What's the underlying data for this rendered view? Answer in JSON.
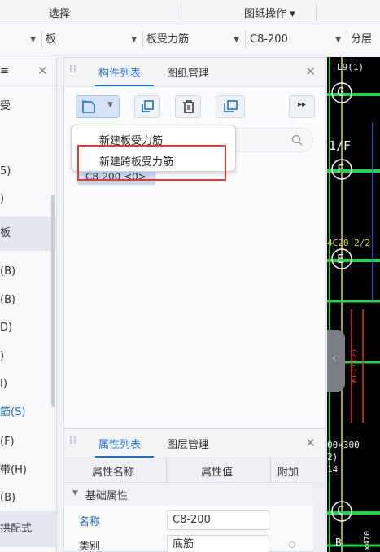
{
  "ribbon": {
    "select_label": "选择",
    "drawing_ops_label": "图纸操作 ▾"
  },
  "combos": {
    "c1": "板",
    "c2": "板受力筋",
    "c3": "C8-200",
    "c4": "分层"
  },
  "left_panel": {
    "header": "≡",
    "items": [
      "受",
      "",
      "5)",
      ")",
      "板",
      "(B)",
      "(B)",
      "D)",
      ")",
      "I)",
      "筋(S)",
      "(F)",
      "带(H)",
      "(B)",
      "拱配式"
    ]
  },
  "component_panel": {
    "tabs": [
      "构件列表",
      "图纸管理"
    ],
    "chip": "C8-200 <0>",
    "menu": [
      "新建板受力筋",
      "新建跨板受力筋"
    ]
  },
  "attr_panel": {
    "tabs": [
      "属性列表",
      "图层管理"
    ],
    "columns": [
      "属性名称",
      "属性值",
      "附加"
    ],
    "group": "基础属性",
    "rows": [
      {
        "name": "名称",
        "value": "C8-200"
      },
      {
        "name": "类别",
        "value": "底筋"
      }
    ]
  },
  "canvas": {
    "labels": [
      "L9(1)",
      "G",
      "1/F",
      "F",
      "4C20 2/2",
      "E",
      "KL17(2)",
      "00×300",
      "2)",
      "14",
      "C",
      "B",
      "x470"
    ]
  },
  "colors": {
    "accent": "#1f6fd1",
    "highlight_red": "#e03c2d",
    "canvas_green": "#1fd64a"
  }
}
